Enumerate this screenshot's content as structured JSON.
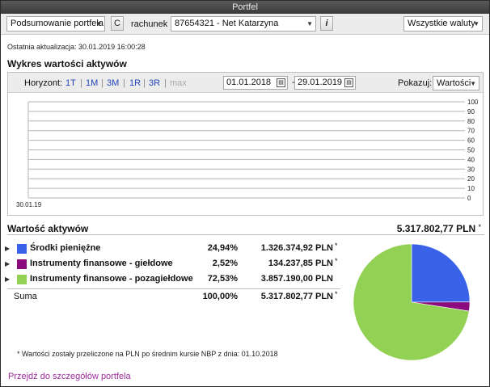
{
  "window": {
    "title": "Portfel"
  },
  "toolbar": {
    "view_select": "Podsumowanie portfela",
    "account_label": "rachunek",
    "account_select": "87654321 - Net Katarzyna",
    "info_icon": "i",
    "currency_select": "Wszystkie waluty",
    "refresh_icon": "C"
  },
  "last_update": "Ostatnia aktualizacja: 30.01.2019 16:00:28",
  "chart_section": {
    "title": "Wykres wartości aktywów",
    "horizon_label": "Horyzont:",
    "horizons": [
      "1T",
      "1M",
      "3M",
      "1R",
      "3R",
      "max"
    ],
    "separator": "|",
    "date_from": "01.01.2018",
    "date_dash": "-",
    "date_to": "29.01.2019",
    "show_label": "Pokazuj:",
    "show_select": "Wartości"
  },
  "chart_data": {
    "type": "line",
    "x": [
      "30.01.19"
    ],
    "series": [],
    "xlabel": "",
    "ylabel": "",
    "ylim": [
      0,
      100
    ],
    "yticks": [
      "0",
      "10",
      "20",
      "30",
      "40",
      "50",
      "60",
      "70",
      "80",
      "90",
      "100"
    ],
    "xticks": [
      "30.01.19"
    ],
    "grid": true
  },
  "assets": {
    "title": "Wartość aktywów",
    "total": "5.317.802,77 PLN",
    "total_asterisk": "*",
    "rows": [
      {
        "name": "Środki pieniężne",
        "pct": "24,94%",
        "value": "1.326.374,92 PLN",
        "asterisk": "*",
        "color": "#3a62e8",
        "fraction": 0.2494
      },
      {
        "name": "Instrumenty finansowe - giełdowe",
        "pct": "2,52%",
        "value": "134.237,85 PLN",
        "asterisk": "*",
        "color": "#8b0b7f",
        "fraction": 0.0252
      },
      {
        "name": "Instrumenty finansowe - pozagiełdowe",
        "pct": "72,53%",
        "value": "3.857.190,00 PLN",
        "asterisk": "",
        "color": "#92d154",
        "fraction": 0.7253
      }
    ],
    "sum": {
      "label": "Suma",
      "pct": "100,00%",
      "value": "5.317.802,77 PLN",
      "asterisk": "*"
    }
  },
  "footnote": "* Wartości zostały przeliczone na PLN po średnim kursie NBP z dnia: 01.10.2018",
  "details_link": "Przejdź do szczegółów portfela"
}
